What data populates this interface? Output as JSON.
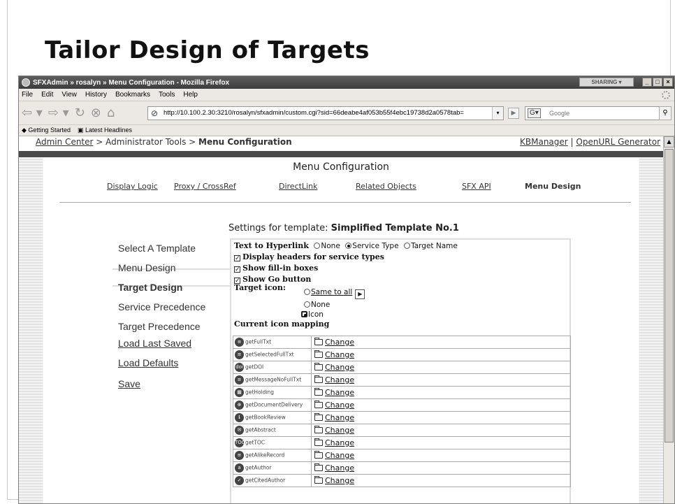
{
  "slide": {
    "title": "Tailor Design of Targets"
  },
  "browser": {
    "window_title": "SFXAdmin » rosalyn » Menu Configuration - Mozilla Firefox",
    "sharing_label": "SHARING",
    "menu": [
      "File",
      "Edit",
      "View",
      "History",
      "Bookmarks",
      "Tools",
      "Help"
    ],
    "url": "http://10.100.2.30:3210/rosalyn/sfxadmin/custom.cgi?sid=66deabe4af053b55f4ebc19738d2a0578tab=",
    "search_placeholder": "Google",
    "bookmarks": [
      "Getting Started",
      "Latest Headlines"
    ]
  },
  "page": {
    "breadcrumb": {
      "part1": "Admin Center",
      "sep1": " > ",
      "part2": "Administrator Tools",
      "sep2": " > ",
      "part3": "Menu Configuration"
    },
    "top_links": {
      "kbmanager": "KBManager",
      "sep": " | ",
      "openurl": "OpenURL Generator"
    },
    "heading": "Menu Configuration",
    "tabs": [
      {
        "label": "Display Logic"
      },
      {
        "label": "Proxy / CrossRef"
      },
      {
        "label": "DirectLink"
      },
      {
        "label": "Related Objects"
      },
      {
        "label": "SFX API"
      },
      {
        "label": "Menu Design"
      }
    ],
    "settings": {
      "prefix": "Settings for template: ",
      "template": "Simplified Template No.1"
    },
    "left_nav": [
      {
        "label": "Select A Template"
      },
      {
        "label": "Menu Design"
      },
      {
        "label": "Target Design"
      },
      {
        "label": "Service Precedence"
      },
      {
        "label": "Target Precedence"
      },
      {
        "label": "Load Last Saved"
      },
      {
        "label": "Load Defaults"
      },
      {
        "label": "Save"
      }
    ],
    "panel": {
      "hyperlink_label": "Text to Hyperlink",
      "hyperlink_options": [
        "None",
        "Service Type",
        "Target Name"
      ],
      "hyperlink_selected": "Service Type",
      "check_headers": "Display headers for service types",
      "check_fillin": "Show fill-in boxes",
      "check_go": "Show Go button",
      "target_icon_label": "Target icon:",
      "icon_options": [
        "Same to all",
        "None",
        "Icon"
      ],
      "icon_selected": "Icon",
      "mapping_label": "Current icon mapping",
      "change_label": "Change",
      "services": [
        "getFullTxt",
        "getSelectedFullTxt",
        "getDOI",
        "getMessageNoFullTxt",
        "getHolding",
        "getDocumentDelivery",
        "getBookReview",
        "getAbstract",
        "getTOC",
        "getAlikeRecord",
        "getAuthor",
        "getCitedAuthor"
      ]
    }
  }
}
